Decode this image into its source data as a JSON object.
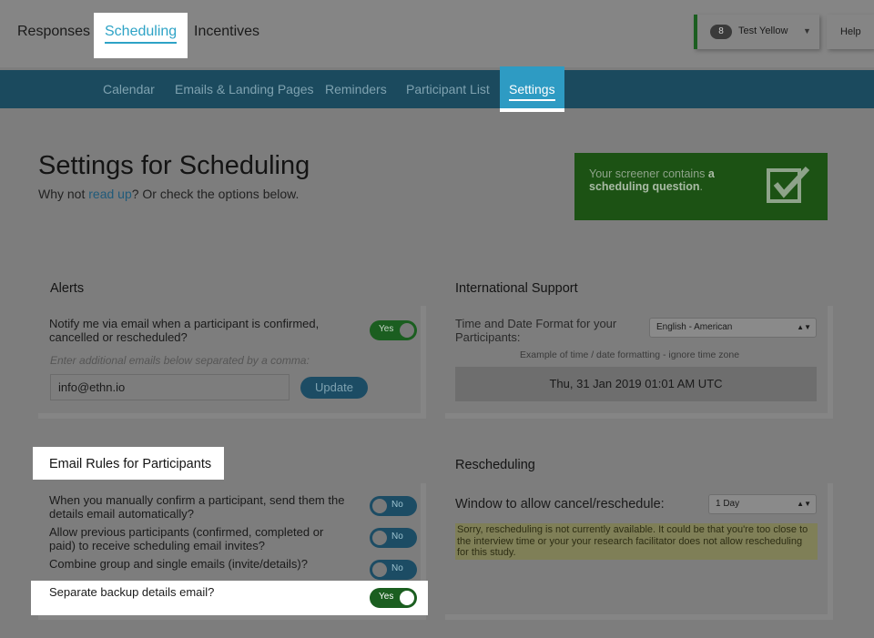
{
  "topnav": {
    "tabs": [
      "Responses",
      "Scheduling",
      "Incentives"
    ],
    "active_tab": "Scheduling",
    "account": {
      "count": "8",
      "name": "Test Yellow"
    },
    "help": "Help"
  },
  "subnav": {
    "items": [
      "Calendar",
      "Emails & Landing Pages",
      "Reminders",
      "Participant List",
      "Settings"
    ],
    "active": "Settings"
  },
  "header": {
    "title": "Settings for Scheduling",
    "sub_prefix": "Why not ",
    "sub_link": "read up",
    "sub_suffix": "? Or check the options below."
  },
  "notice": {
    "text_prefix": "Your screener contains ",
    "text_bold": "a scheduling question",
    "text_suffix": "."
  },
  "alerts": {
    "title": "Alerts",
    "notify_label": "Notify me via email when a participant is confirmed, cancelled or rescheduled?",
    "notify_toggle": "Yes",
    "hint": "Enter additional emails below separated by a comma:",
    "email_value": "info@ethn.io",
    "update_label": "Update"
  },
  "international": {
    "title": "International Support",
    "format_label": "Time and Date Format for your Participants:",
    "format_value": "English - American",
    "example_label": "Example of time / date formatting - ignore time zone",
    "example_value": "Thu, 31 Jan 2019 01:01 AM UTC"
  },
  "email_rules": {
    "title": "Email Rules for Participants",
    "rules": [
      {
        "label": "When you manually confirm a participant, send them the details email automatically?",
        "toggle": "No"
      },
      {
        "label": "Allow previous participants (confirmed, completed or paid) to receive scheduling email invites?",
        "toggle": "No"
      },
      {
        "label": "Combine group and single emails (invite/details)?",
        "toggle": "No"
      },
      {
        "label": "Separate backup details email?",
        "toggle": "Yes"
      }
    ]
  },
  "rescheduling": {
    "title": "Rescheduling",
    "window_label": "Window to allow cancel/reschedule:",
    "window_value": "1 Day",
    "warning": "Sorry, rescheduling is not currently available. It could be that you're too close to the interview time or your your research facilitator does not allow rescheduling for this study."
  },
  "colors": {
    "accent": "#2ea3c6",
    "subnav_bg": "#1b4a5e",
    "success": "#1b5e20"
  }
}
